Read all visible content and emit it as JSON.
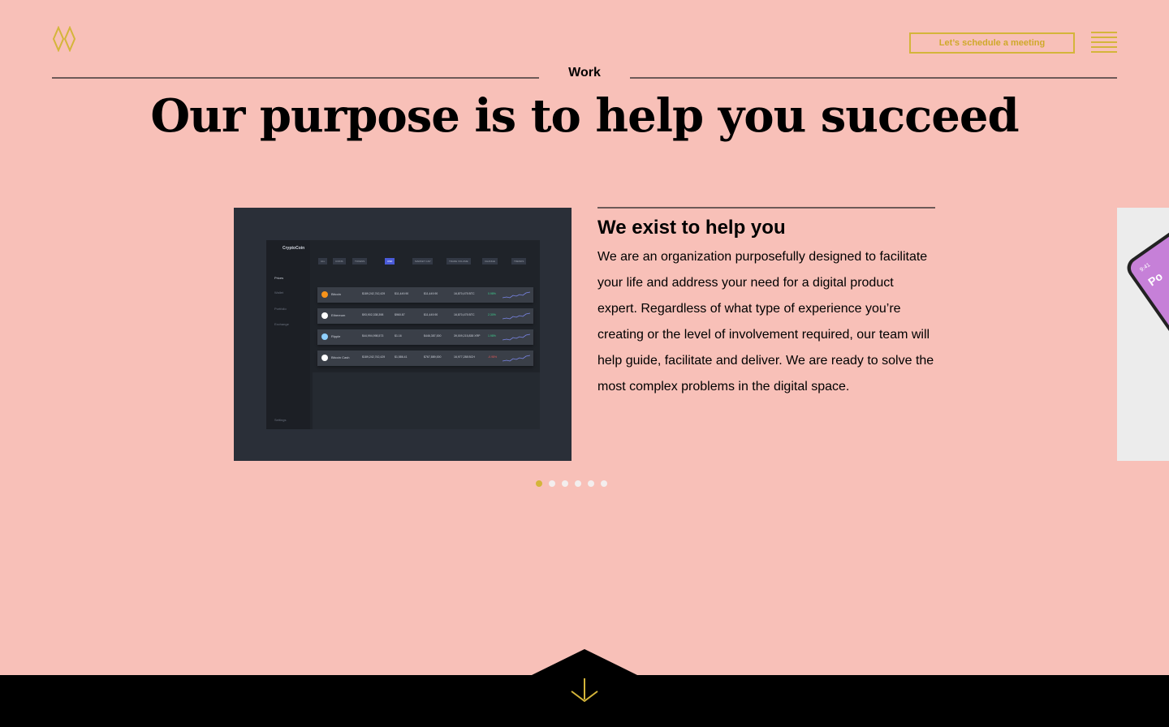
{
  "header": {
    "cta_label": "Let’s schedule a meeting",
    "logo_icon": "diamond-logo-icon",
    "menu_icon": "hamburger-menu-icon",
    "accent_color": "#d4b53a"
  },
  "section": {
    "label": "Work",
    "headline": "Our purpose is to help you succeed"
  },
  "slide": {
    "title": "We exist to help you",
    "body": "We are an organization purposefully designed to facilitate your life and address your need for a digital product expert. Regardless of what type of experience you’re creating or the level of involvement required, our team will help guide, facilitate and deliver. We are ready to solve the most complex problems in the digital space.",
    "mockup": {
      "brand": "CryptoCoin",
      "sidebar": [
        "Prices",
        "Wallet",
        "Portfolio",
        "Exchange"
      ],
      "settings": "Settings",
      "filters": [
        "ALL",
        "COINS",
        "TOKENS",
        "USD",
        "MARKET CAP",
        "TRADE VOLUME",
        "CHANGE",
        "TRENDS"
      ],
      "rows": [
        {
          "name": "Bitcoin",
          "cap": "$189,242,742,429",
          "price": "$11,449.90",
          "volume": "$11,449.90",
          "supply": "16,870,475 BTC",
          "change": "0.98%",
          "color": "#f7931a",
          "up": true
        },
        {
          "name": "Ethereum",
          "cap": "$93,902,338,398",
          "price": "$960.87",
          "volume": "$11,449.90",
          "supply": "16,870,475 BTC",
          "change": "2.30%",
          "color": "#ffffff",
          "up": true
        },
        {
          "name": "Ripple",
          "cap": "$44,994,998,573",
          "price": "$1.16",
          "volume": "$446,387,000",
          "supply": "39,009,215,838 XRP",
          "change": "1.98%",
          "color": "#8fd0ff",
          "up": true
        },
        {
          "name": "Bitcoin Cash",
          "cap": "$189,242,742,429",
          "price": "$1,586.41",
          "volume": "$767,889,000",
          "supply": "16,977,288 BCH",
          "change": "-0.98%",
          "color": "#ffffff",
          "up": false
        }
      ]
    }
  },
  "carousel": {
    "count": 6,
    "active": 0
  },
  "phone_peek": {
    "time": "9:41",
    "text": "Po"
  },
  "footer": {
    "down_icon": "arrow-down-icon"
  }
}
